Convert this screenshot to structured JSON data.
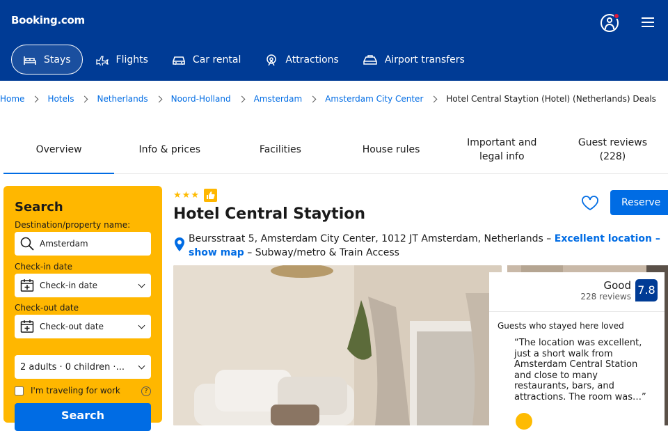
{
  "header": {
    "logo": "Booking.com",
    "nav": [
      {
        "label": "Stays",
        "icon": "bed-icon",
        "active": true
      },
      {
        "label": "Flights",
        "icon": "plane-icon"
      },
      {
        "label": "Car rental",
        "icon": "car-icon"
      },
      {
        "label": "Attractions",
        "icon": "attractions-icon"
      },
      {
        "label": "Airport transfers",
        "icon": "taxi-icon"
      }
    ]
  },
  "breadcrumb": [
    "Home",
    "Hotels",
    "Netherlands",
    "Noord-Holland",
    "Amsterdam",
    "Amsterdam City Center",
    "Hotel Central Staytion (Hotel) (Netherlands) Deals"
  ],
  "tabs": [
    {
      "label": "Overview",
      "active": true
    },
    {
      "label": "Info & prices"
    },
    {
      "label": "Facilities"
    },
    {
      "label": "House rules"
    },
    {
      "label": "Important and legal info"
    },
    {
      "label": "Guest reviews (228)"
    }
  ],
  "search": {
    "title": "Search",
    "destination_label": "Destination/property name:",
    "destination_value": "Amsterdam",
    "checkin_label": "Check-in date",
    "checkin_value": "Check-in date",
    "checkout_label": "Check-out date",
    "checkout_value": "Check-out date",
    "guests_value": "2 adults · 0 children ·...",
    "work_label": "I'm traveling for work",
    "help": "?",
    "button_label": "Search"
  },
  "hotel": {
    "stars": 3,
    "name": "Hotel Central Staytion",
    "reserve_label": "Reserve",
    "address": "Beursstraat 5, Amsterdam City Center, 1012 JT Amsterdam, Netherlands –",
    "location_link": "Excellent location – show map",
    "access": "– Subway/metro & Train Access"
  },
  "review": {
    "rating_word": "Good",
    "count": "228 reviews",
    "score": "7.8",
    "loved_label": "Guests who stayed here loved",
    "quote": "“The location was excellent, just a short walk from Amsterdam Central Station and close to many restaurants, bars, and attractions. The room was…”"
  },
  "colors": {
    "brand_blue": "#003b95",
    "link_blue": "#006ce4",
    "yellow": "#ffb700"
  }
}
